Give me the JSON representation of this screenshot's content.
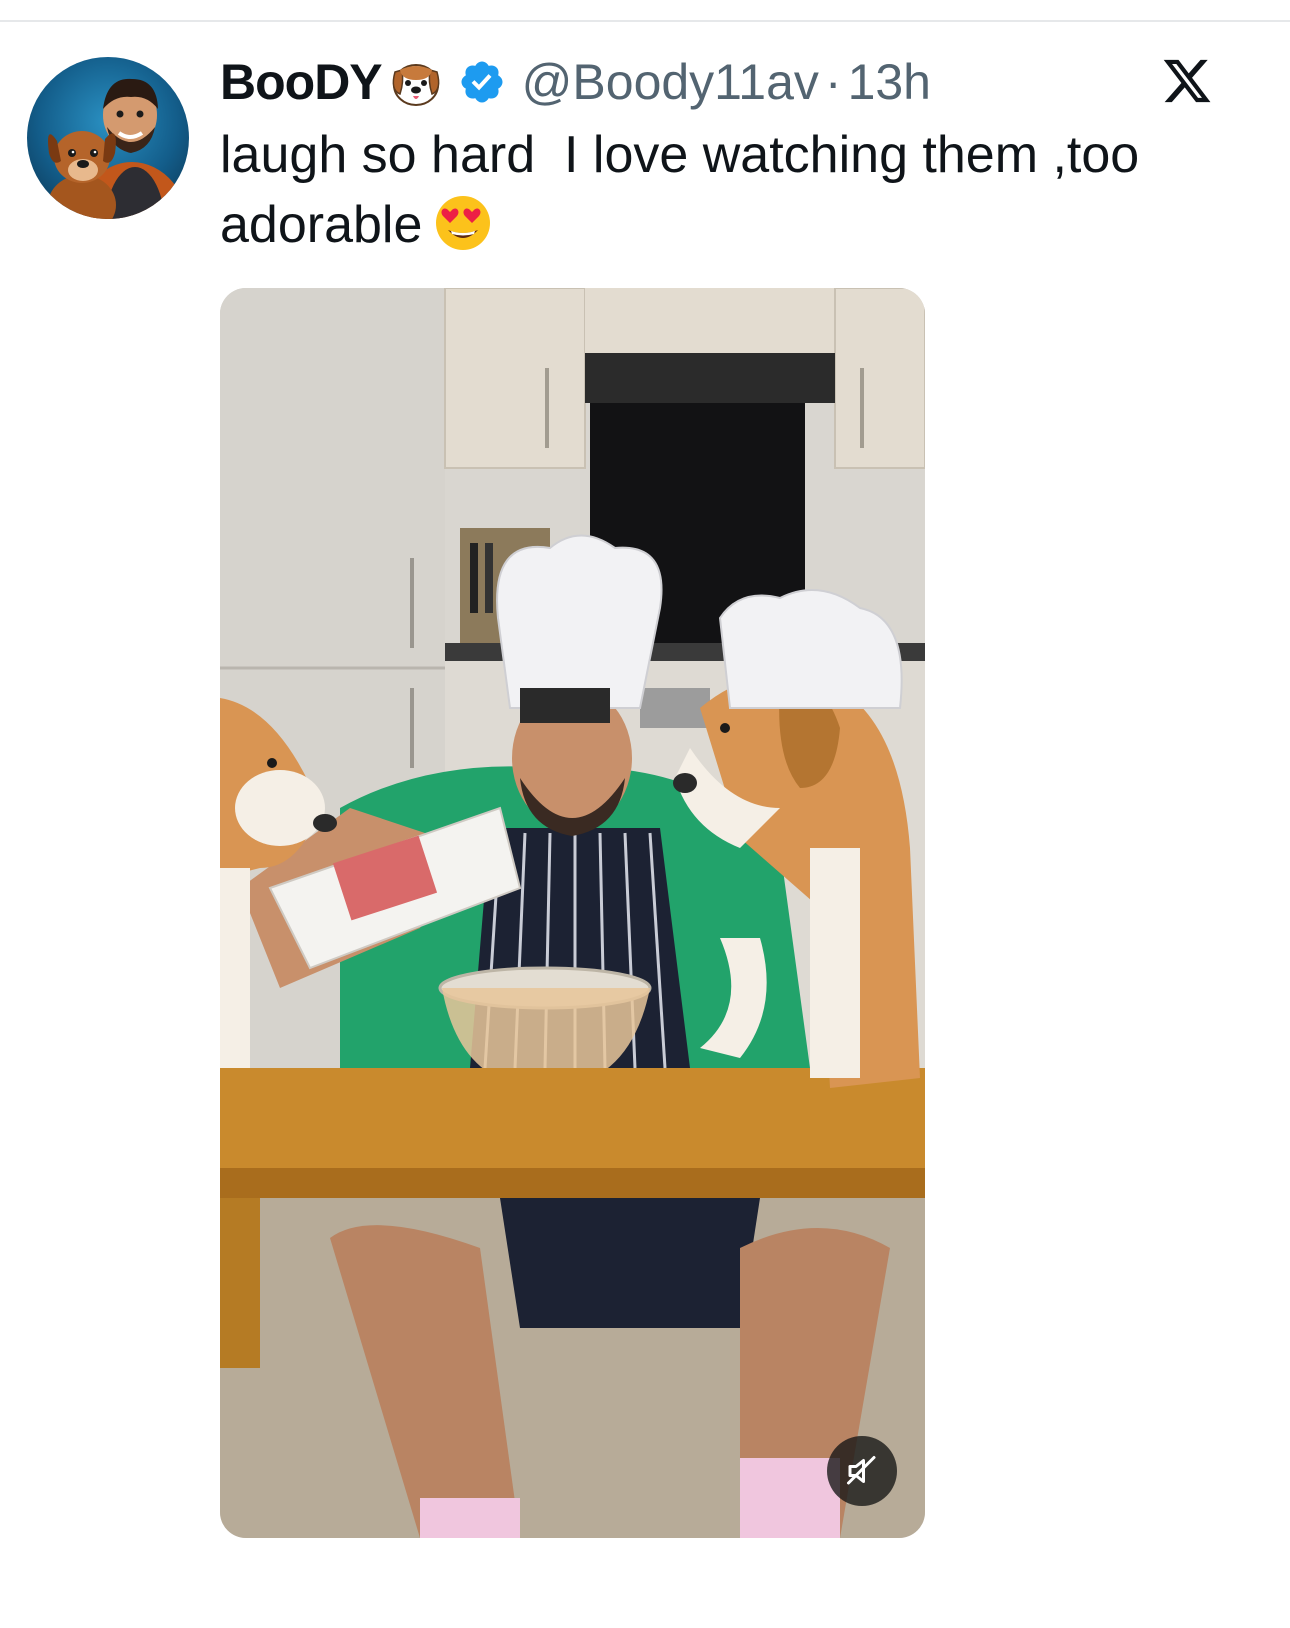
{
  "tweet": {
    "author": {
      "display_name": "BooDY",
      "name_emoji": "dog-face-emoji",
      "verified_badge": "verified-check-icon",
      "handle": "@Boody11av",
      "separator": "·",
      "timestamp": "13h",
      "avatar": "avatar-man-with-dog"
    },
    "text": "laugh so hard  I love watching them ,too adorable",
    "text_emoji": "smiling-face-with-heart-eyes-emoji",
    "platform_logo": "x-logo",
    "media": {
      "type": "video",
      "description": "video-thumbnail-man-cooking-with-two-beagles",
      "mute_icon": "muted-speaker-icon"
    }
  },
  "colors": {
    "text_primary": "#0f1419",
    "text_secondary": "#536471",
    "verified_blue": "#1d9bf0",
    "divider": "#e6e8ea"
  }
}
